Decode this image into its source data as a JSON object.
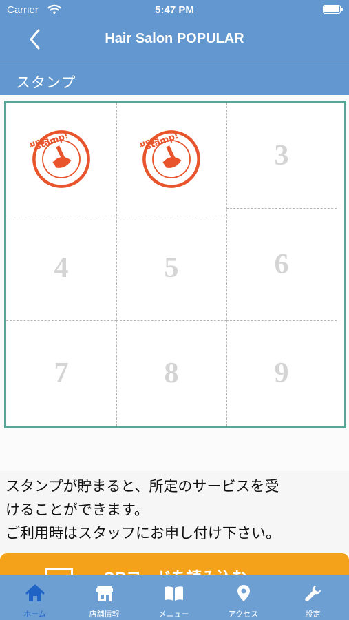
{
  "status_bar": {
    "carrier": "Carrier",
    "time": "5:47 PM"
  },
  "nav": {
    "title": "Hair Salon POPULAR"
  },
  "section": {
    "title": "スタンプ"
  },
  "stamp_card": {
    "stamp_text": "stamp!",
    "cells": [
      {
        "label": "",
        "stamped": true
      },
      {
        "label": "",
        "stamped": true
      },
      {
        "label": "3",
        "stamped": false
      },
      {
        "label": "4",
        "stamped": false
      },
      {
        "label": "5",
        "stamped": false
      },
      {
        "label": "6",
        "stamped": false
      },
      {
        "label": "7",
        "stamped": false
      },
      {
        "label": "8",
        "stamped": false
      },
      {
        "label": "9",
        "stamped": false
      }
    ],
    "stamp_color": "#e8542b",
    "border_color": "#5aa595"
  },
  "description": {
    "lines": [
      "スタンプが貯まると、所定のサービスを受",
      "けることができます。",
      "ご利用時はスタッフにお申し付け下さい。"
    ]
  },
  "cta_button": {
    "label": "QRコードを読み込む"
  },
  "tabbar": {
    "items": [
      {
        "label": "ホーム",
        "icon": "home-icon",
        "active": true
      },
      {
        "label": "店舗情報",
        "icon": "store-icon",
        "active": false
      },
      {
        "label": "メニュー",
        "icon": "book-icon",
        "active": false
      },
      {
        "label": "アクセス",
        "icon": "location-pin-icon",
        "active": false
      },
      {
        "label": "設定",
        "icon": "wrench-icon",
        "active": false
      }
    ],
    "active_color": "#1f63c4"
  },
  "colors": {
    "header": "#6298cf",
    "tabbar": "#6d9fd3",
    "cta": "#f4a21a"
  }
}
